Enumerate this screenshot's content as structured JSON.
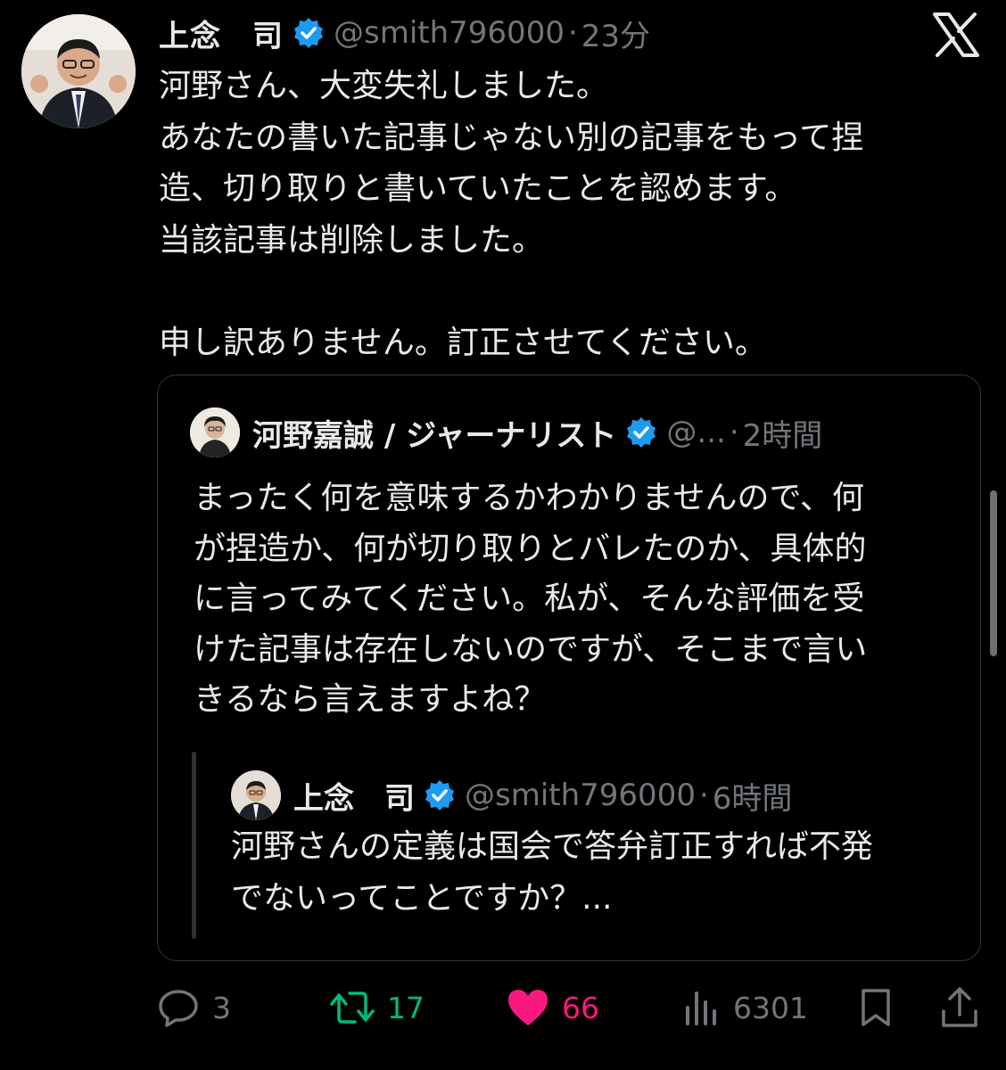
{
  "tweet": {
    "author_name": "上念　司",
    "handle": "@smith796000",
    "separator": "·",
    "time": "23分",
    "lines": [
      "河野さん、大変失礼しました。",
      "あなたの書いた記事じゃない別の記事をもって捏",
      "造、切り取りと書いていたことを認めます。",
      "当該記事は削除しました。",
      "",
      "申し訳ありません。訂正させてください。"
    ]
  },
  "quoted": {
    "author_name": "河野嘉誠 / ジャーナリスト",
    "handle": "@...",
    "separator": "·",
    "time": "2時間",
    "lines": [
      "まったく何を意味するかわかりませんので、何",
      "が捏造か、何が切り取りとバレたのか、具体的",
      "に言ってみてください。私が、そんな評価を受",
      "けた記事は存在しないのですが、そこまで言い",
      "きるなら言えますよね？"
    ]
  },
  "nested": {
    "author_name": "上念　司",
    "handle": "@smith796000",
    "separator": "·",
    "time": "6時間",
    "lines": [
      "河野さんの定義は国会で答弁訂正すれば不発",
      "でないってことですか？..."
    ]
  },
  "actions": {
    "reply_count": "3",
    "retweet_count": "17",
    "like_count": "66",
    "views_count": "6301"
  },
  "icons": {
    "close": "x-logo-icon",
    "verified": "verified-badge-icon",
    "reply": "reply-icon",
    "retweet": "retweet-icon",
    "like": "heart-icon",
    "views": "views-icon",
    "bookmark": "bookmark-icon",
    "share": "share-icon"
  },
  "colors": {
    "background": "#000000",
    "text": "#e7e9ea",
    "muted": "#71767b",
    "verified": "#1d9bf0",
    "retweet": "#00ba7c",
    "like": "#f91880",
    "border": "#333639"
  }
}
